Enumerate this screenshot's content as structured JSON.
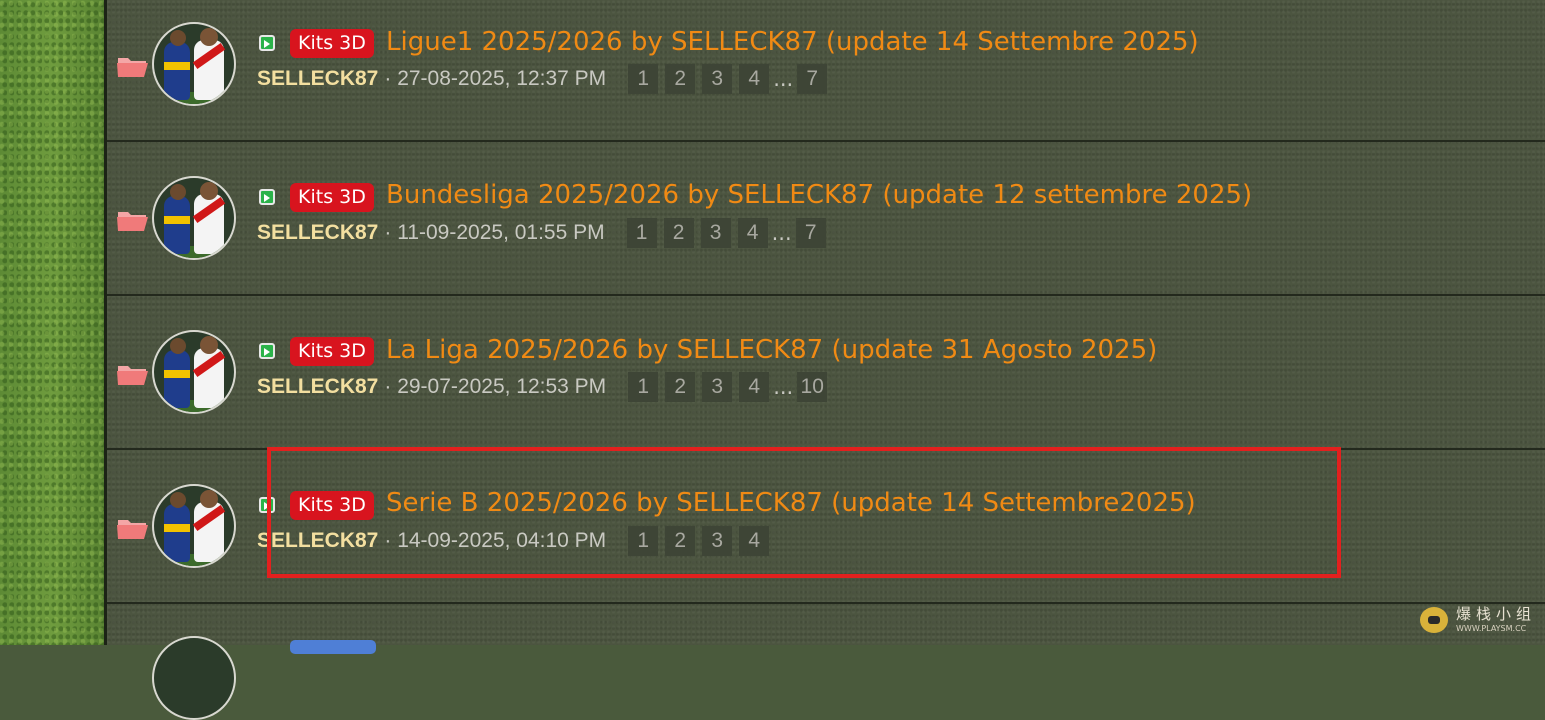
{
  "topics": [
    {
      "badge": "Kits 3D",
      "title": "Ligue1 2025/2026 by SELLECK87 (update 14 Settembre 2025)",
      "author": "SELLECK87",
      "date": "· 27-08-2025, 12:37 PM",
      "pages": [
        "1",
        "2",
        "3",
        "4"
      ],
      "ellipsis": "...",
      "last_page": "7"
    },
    {
      "badge": "Kits 3D",
      "title": "Bundesliga 2025/2026 by SELLECK87 (update 12 settembre 2025)",
      "author": "SELLECK87",
      "date": "· 11-09-2025, 01:55 PM",
      "pages": [
        "1",
        "2",
        "3",
        "4"
      ],
      "ellipsis": "...",
      "last_page": "7"
    },
    {
      "badge": "Kits 3D",
      "title": "La Liga 2025/2026 by SELLECK87 (update 31 Agosto 2025)",
      "author": "SELLECK87",
      "date": "· 29-07-2025, 12:53 PM",
      "pages": [
        "1",
        "2",
        "3",
        "4"
      ],
      "ellipsis": "...",
      "last_page": "10"
    },
    {
      "badge": "Kits 3D",
      "title": "Serie B 2025/2026 by SELLECK87 (update 14 Settembre2025)",
      "author": "SELLECK87",
      "date": "· 14-09-2025, 04:10 PM",
      "pages": [
        "1",
        "2",
        "3",
        "4"
      ]
    }
  ],
  "watermark": {
    "main": "爆栈小组",
    "sub": "WWW.PLAYSM.CC"
  },
  "colors": {
    "title": "#f08a14",
    "badge": "#d8141e",
    "author": "#f3dfa0",
    "highlight": "#e3201e"
  }
}
